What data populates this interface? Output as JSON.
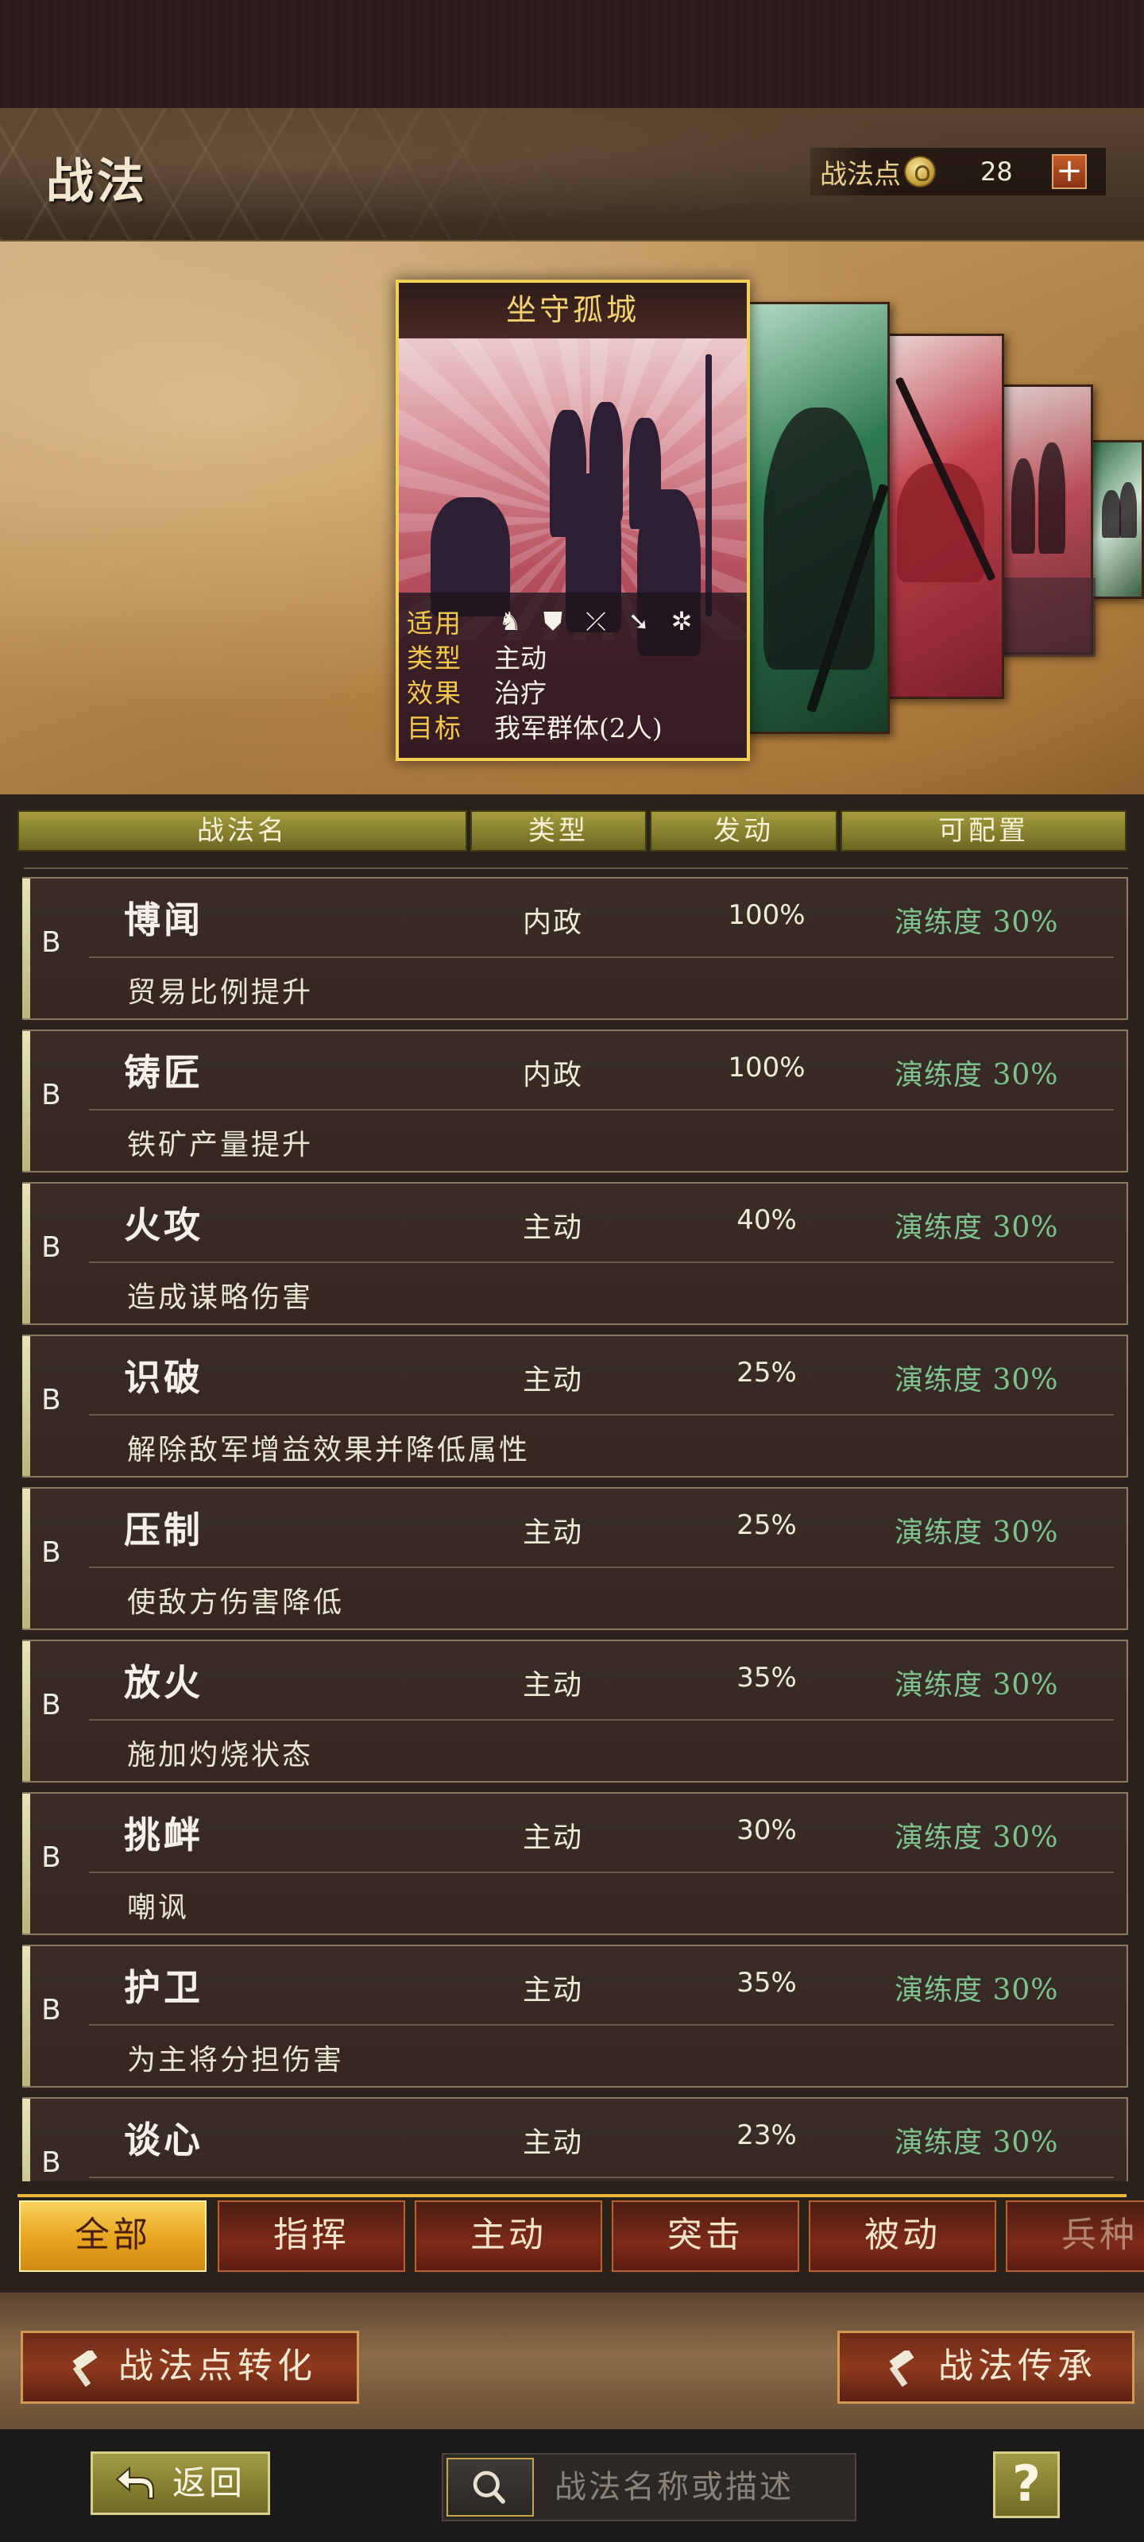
{
  "header": {
    "title": "战法",
    "points_label": "战法点",
    "points_value": "28",
    "plus_label": "+"
  },
  "featured_card": {
    "name": "坐守孤城",
    "applies_label": "适用",
    "applies_icons": [
      "cavalry-icon",
      "shield-icon",
      "bow-icon",
      "spear-icon",
      "wheel-icon"
    ],
    "type_label": "类型",
    "type_value": "主动",
    "effect_label": "效果",
    "effect_value": "治疗",
    "target_label": "目标",
    "target_value": "我军群体(2人)"
  },
  "columns": {
    "name": "战法名",
    "type": "类型",
    "rate": "发动",
    "config": "可配置"
  },
  "skills": [
    {
      "grade": "B",
      "name": "博闻",
      "type": "内政",
      "rate": "100%",
      "config": "演练度 30%",
      "desc": "贸易比例提升"
    },
    {
      "grade": "B",
      "name": "铸匠",
      "type": "内政",
      "rate": "100%",
      "config": "演练度 30%",
      "desc": "铁矿产量提升"
    },
    {
      "grade": "B",
      "name": "火攻",
      "type": "主动",
      "rate": "40%",
      "config": "演练度 30%",
      "desc": "造成谋略伤害"
    },
    {
      "grade": "B",
      "name": "识破",
      "type": "主动",
      "rate": "25%",
      "config": "演练度 30%",
      "desc": "解除敌军增益效果并降低属性"
    },
    {
      "grade": "B",
      "name": "压制",
      "type": "主动",
      "rate": "25%",
      "config": "演练度 30%",
      "desc": "使敌方伤害降低"
    },
    {
      "grade": "B",
      "name": "放火",
      "type": "主动",
      "rate": "35%",
      "config": "演练度 30%",
      "desc": "施加灼烧状态"
    },
    {
      "grade": "B",
      "name": "挑衅",
      "type": "主动",
      "rate": "30%",
      "config": "演练度 30%",
      "desc": "嘲讽"
    },
    {
      "grade": "B",
      "name": "护卫",
      "type": "主动",
      "rate": "35%",
      "config": "演练度 30%",
      "desc": "为主将分担伤害"
    },
    {
      "grade": "B",
      "name": "谈心",
      "type": "主动",
      "rate": "23%",
      "config": "演练度 30%",
      "desc": ""
    }
  ],
  "tabs": [
    "全部",
    "指挥",
    "主动",
    "突击",
    "被动",
    "兵种"
  ],
  "active_tab": "全部",
  "actions": {
    "convert_label": "战法点转化",
    "inherit_label": "战法传承"
  },
  "bottom": {
    "back_label": "返回",
    "search_placeholder": "战法名称或描述",
    "help_label": "?"
  },
  "colors": {
    "accent_gold": "#f2cf55",
    "config_green": "#7fc28f",
    "active_tab": "#e8a31d"
  }
}
